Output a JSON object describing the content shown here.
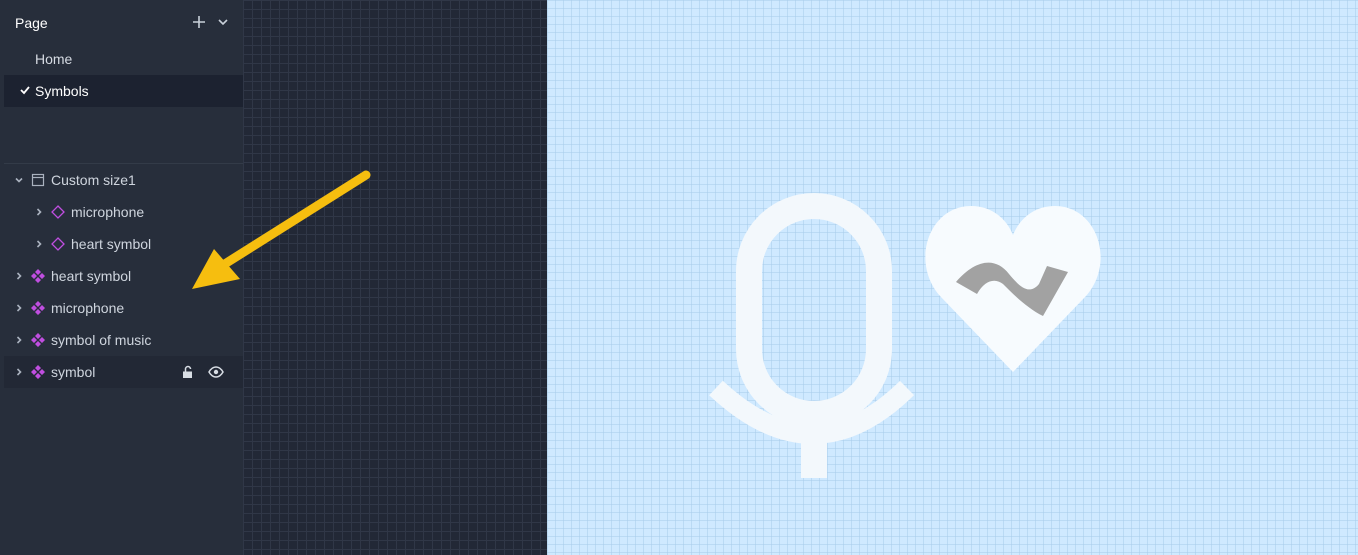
{
  "pages": {
    "title": "Page",
    "items": [
      {
        "label": "Home",
        "active": false
      },
      {
        "label": "Symbols",
        "active": true
      }
    ]
  },
  "layers": [
    {
      "label": "Custom size1",
      "icon": "artboard-icon",
      "expanded": true
    },
    {
      "label": "microphone",
      "icon": "symbol-outline-icon",
      "child": true
    },
    {
      "label": "heart symbol",
      "icon": "symbol-outline-icon",
      "child": true
    },
    {
      "label": "heart symbol",
      "icon": "symbol-master-icon"
    },
    {
      "label": "microphone",
      "icon": "symbol-master-icon"
    },
    {
      "label": "symbol of music",
      "icon": "symbol-master-icon"
    },
    {
      "label": "symbol",
      "icon": "symbol-master-icon",
      "selected": true
    }
  ],
  "colors": {
    "sidebar": "#272e3b",
    "symbol_accent": "#c04ee0",
    "annotation_arrow": "#f6be0f",
    "artboard": "#cfe9ff"
  }
}
